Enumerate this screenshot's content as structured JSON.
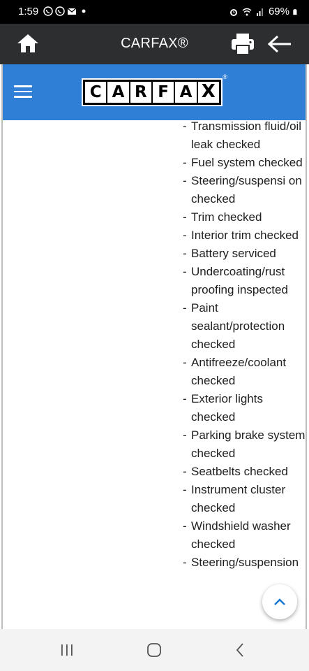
{
  "status_bar": {
    "time": "1:59",
    "battery": "69%",
    "icons": [
      "viber-icon",
      "viber-icon",
      "mail-icon",
      "dot-icon",
      "alarm-icon",
      "wifi-icon",
      "signal-icon",
      "battery-icon"
    ]
  },
  "app_bar": {
    "title": "CARFAX®",
    "icons": [
      "home-icon",
      "print-icon",
      "back-arrow-icon"
    ]
  },
  "site_header": {
    "color": "#2f7fd6",
    "logo_letters": [
      "C",
      "A",
      "R",
      "F",
      "A",
      "X"
    ],
    "logo_reg": "®",
    "icons": [
      "hamburger-menu-icon"
    ]
  },
  "service_items": [
    "Transmission fluid/oil leak checked",
    "Fuel system checked",
    "Steering/suspensi on checked",
    "Trim checked",
    "Interior trim checked",
    "Battery serviced",
    "Undercoating/rust proofing inspected",
    "Paint sealant/protection checked",
    "Antifreeze/coolant checked",
    "Exterior lights checked",
    "Parking brake system checked",
    "Seatbelts checked",
    "Instrument cluster checked",
    "Windshield washer checked",
    "Steering/suspension"
  ],
  "fab": {
    "icon": "chevron-up-icon",
    "color": "#1976d2"
  },
  "nav_bar": {
    "icons": [
      "recent-apps-icon",
      "home-circle-icon",
      "back-chevron-icon"
    ]
  }
}
